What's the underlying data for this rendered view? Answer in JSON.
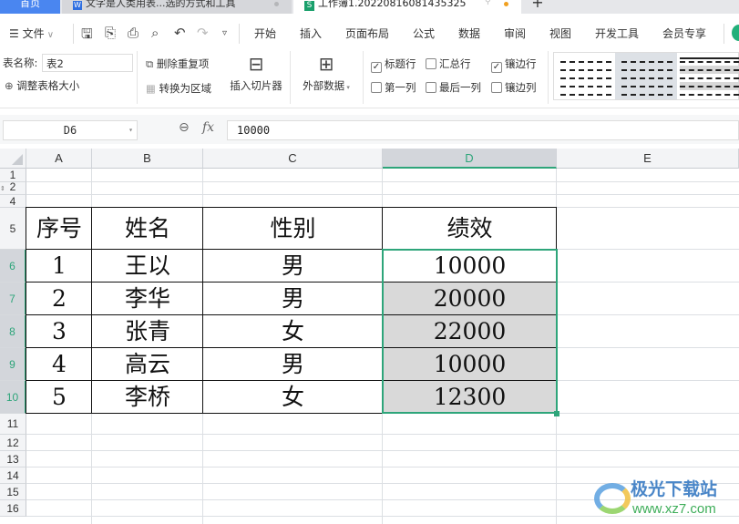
{
  "tabs": [
    {
      "label": "首页",
      "icon": "home"
    },
    {
      "label": "文字是人类用表...选的方式和工具",
      "icon": "writer-doc-icon"
    },
    {
      "label": "工作簿1.20220816081435325",
      "icon": "spreadsheet-icon"
    }
  ],
  "menu": {
    "file": "文件",
    "items": [
      "开始",
      "插入",
      "页面布局",
      "公式",
      "数据",
      "审阅",
      "视图",
      "开发工具",
      "会员专享"
    ]
  },
  "ribbon": {
    "table_name_label": "表名称:",
    "table_name_value": "表2",
    "resize_table": "调整表格大小",
    "remove_duplicates": "删除重复项",
    "convert_to_range": "转换为区域",
    "insert_slicer": "插入切片器",
    "external_data": "外部数据",
    "options": [
      {
        "label": "标题行",
        "checked": true
      },
      {
        "label": "汇总行",
        "checked": false
      },
      {
        "label": "镶边行",
        "checked": true
      },
      {
        "label": "第一列",
        "checked": false
      },
      {
        "label": "最后一列",
        "checked": false
      },
      {
        "label": "镶边列",
        "checked": false
      }
    ]
  },
  "formula_bar": {
    "name_box": "D6",
    "fx": "fx",
    "value": "10000"
  },
  "sheet": {
    "columns": [
      "A",
      "B",
      "C",
      "D",
      "E"
    ],
    "selected_column": "D",
    "rows": [
      "1",
      "2",
      "4",
      "5",
      "6",
      "7",
      "8",
      "9",
      "10",
      "11",
      "12",
      "13",
      "14",
      "15",
      "16"
    ],
    "selected_rows": [
      "6",
      "7",
      "8",
      "9",
      "10"
    ],
    "header": [
      "序号",
      "姓名",
      "性别",
      "绩效"
    ],
    "data": [
      [
        "1",
        "王以",
        "男",
        "10000"
      ],
      [
        "2",
        "李华",
        "男",
        "20000"
      ],
      [
        "3",
        "张青",
        "女",
        "22000"
      ],
      [
        "4",
        "高云",
        "男",
        "10000"
      ],
      [
        "5",
        "李桥",
        "女",
        "12300"
      ]
    ],
    "selection": "D6:D10",
    "active_cell": "D6"
  },
  "watermark": {
    "name": "极光下载站",
    "url": "www.xz7.com"
  }
}
